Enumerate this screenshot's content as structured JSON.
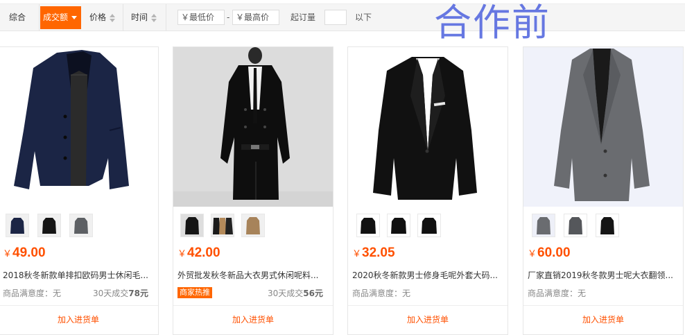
{
  "sortbar": {
    "comprehensive": "综合",
    "sales": "成交额",
    "price": "价格",
    "time": "时间",
    "price_min_placeholder": "￥最低价",
    "dash": "-",
    "price_max_placeholder": "￥最高价",
    "min_order_label": "起订量",
    "min_order_value": "",
    "below_label": "以下"
  },
  "watermark": "合作前",
  "colors": {
    "accent": "#ff6600",
    "price": "#ff5000",
    "watermark": "#5a6de0"
  },
  "products": [
    {
      "image_icon": "navy-wool-overcoat",
      "thumb_icons": [
        "navy-coat-thumb",
        "black-coat-thumb",
        "grey-coat-thumb"
      ],
      "price_symbol": "￥",
      "price": "49.00",
      "title": "2018秋冬新款单排扣欧码男士休闲毛...",
      "satisfaction": "商品满意度：无",
      "sales_prefix": "30天成交",
      "sales_count": "78元",
      "badge": "",
      "add_label": "加入进货单"
    },
    {
      "image_icon": "black-double-breasted-coat",
      "thumb_icons": [
        "black-coat-thumb",
        "camel-coat-thumb",
        "khaki-coat-thumb"
      ],
      "price_symbol": "￥",
      "price": "42.00",
      "title": "外贸批发秋冬新品大衣男式休闲呢料...",
      "satisfaction": "",
      "sales_prefix": "30天成交",
      "sales_count": "56元",
      "badge": "商家热推",
      "add_label": "加入进货单"
    },
    {
      "image_icon": "black-blazer",
      "thumb_icons": [
        "black-blazer-thumb",
        "black-blazer-thumb",
        "black-blazer-thumb"
      ],
      "price_symbol": "￥",
      "price": "32.05",
      "title": "2020秋冬新款男士修身毛呢外套大码...",
      "satisfaction": "商品满意度：无",
      "sales_prefix": "",
      "sales_count": "",
      "badge": "",
      "add_label": "加入进货单"
    },
    {
      "image_icon": "grey-wool-overcoat",
      "thumb_icons": [
        "grey-coat-thumb",
        "grey-coat-thumb",
        "black-coat-thumb"
      ],
      "price_symbol": "￥",
      "price": "60.00",
      "title": "厂家直销2019秋冬款男士呢大衣翻领...",
      "satisfaction": "商品满意度：无",
      "sales_prefix": "",
      "sales_count": "",
      "badge": "",
      "add_label": "加入进货单"
    }
  ]
}
